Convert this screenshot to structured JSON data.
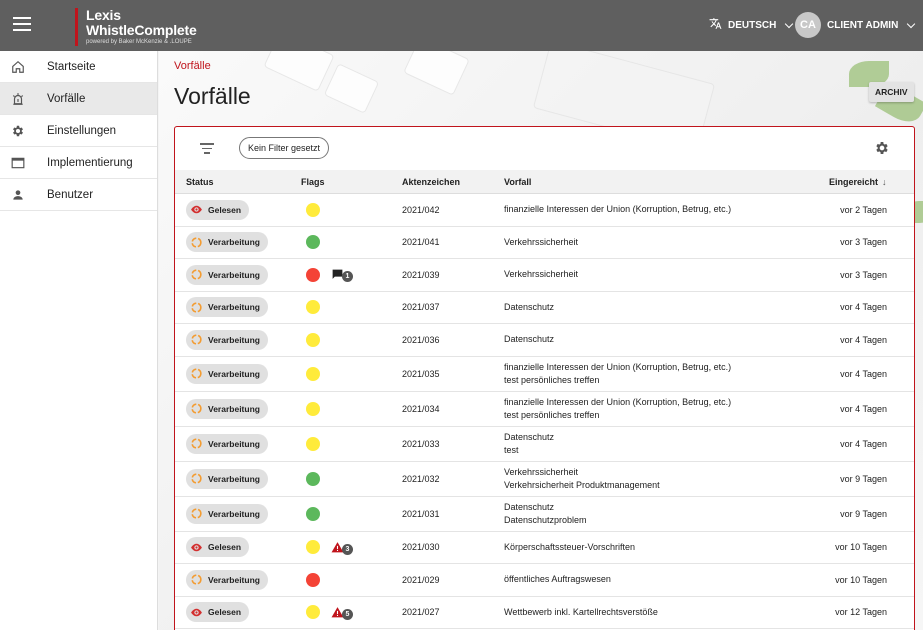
{
  "app": {
    "logo_line1": "Lexis",
    "logo_line2": "WhistleComplete",
    "logo_sub": "powered by Baker McKenzie & .LOUPE"
  },
  "header": {
    "language": "DEUTSCH",
    "user_initials": "CA",
    "user_name": "CLIENT ADMIN"
  },
  "sidebar": {
    "items": [
      {
        "label": "Startseite",
        "icon": "home-icon"
      },
      {
        "label": "Vorfälle",
        "icon": "incident-alarm-icon",
        "active": true
      },
      {
        "label": "Einstellungen",
        "icon": "gear-icon"
      },
      {
        "label": "Implementierung",
        "icon": "window-icon"
      },
      {
        "label": "Benutzer",
        "icon": "person-icon"
      }
    ]
  },
  "page": {
    "breadcrumb": "Vorfälle",
    "title": "Vorfälle",
    "archive_button": "ARCHIV"
  },
  "filter": {
    "chip_label": "Kein Filter gesetzt"
  },
  "table": {
    "columns": {
      "status": "Status",
      "flags": "Flags",
      "reference": "Aktenzeichen",
      "incident": "Vorfall",
      "received": "Eingereicht"
    },
    "rows": [
      {
        "status": "Gelesen",
        "status_type": "read",
        "flag_color": "#ffeb3b",
        "extra": null,
        "extra_count": null,
        "ref": "2021/042",
        "incident": [
          "finanzielle Interessen der Union (Korruption, Betrug, etc.)"
        ],
        "received": "vor 2 Tagen"
      },
      {
        "status": "Verarbeitung",
        "status_type": "processing",
        "flag_color": "#5cb85c",
        "extra": null,
        "extra_count": null,
        "ref": "2021/041",
        "incident": [
          "Verkehrssicherheit"
        ],
        "received": "vor 3 Tagen"
      },
      {
        "status": "Verarbeitung",
        "status_type": "processing",
        "flag_color": "#f44336",
        "extra": "message",
        "extra_count": "1",
        "ref": "2021/039",
        "incident": [
          "Verkehrssicherheit"
        ],
        "received": "vor 3 Tagen"
      },
      {
        "status": "Verarbeitung",
        "status_type": "processing",
        "flag_color": "#ffeb3b",
        "extra": null,
        "extra_count": null,
        "ref": "2021/037",
        "incident": [
          "Datenschutz"
        ],
        "received": "vor 4 Tagen"
      },
      {
        "status": "Verarbeitung",
        "status_type": "processing",
        "flag_color": "#ffeb3b",
        "extra": null,
        "extra_count": null,
        "ref": "2021/036",
        "incident": [
          "Datenschutz"
        ],
        "received": "vor 4 Tagen"
      },
      {
        "status": "Verarbeitung",
        "status_type": "processing",
        "flag_color": "#ffeb3b",
        "extra": null,
        "extra_count": null,
        "ref": "2021/035",
        "incident": [
          "finanzielle Interessen der Union (Korruption, Betrug, etc.)",
          "test persönliches treffen"
        ],
        "received": "vor 4 Tagen"
      },
      {
        "status": "Verarbeitung",
        "status_type": "processing",
        "flag_color": "#ffeb3b",
        "extra": null,
        "extra_count": null,
        "ref": "2021/034",
        "incident": [
          "finanzielle Interessen der Union (Korruption, Betrug, etc.)",
          "test persönliches treffen"
        ],
        "received": "vor 4 Tagen"
      },
      {
        "status": "Verarbeitung",
        "status_type": "processing",
        "flag_color": "#ffeb3b",
        "extra": null,
        "extra_count": null,
        "ref": "2021/033",
        "incident": [
          "Datenschutz",
          "test"
        ],
        "received": "vor 4 Tagen"
      },
      {
        "status": "Verarbeitung",
        "status_type": "processing",
        "flag_color": "#5cb85c",
        "extra": null,
        "extra_count": null,
        "ref": "2021/032",
        "incident": [
          "Verkehrssicherheit",
          "Verkehrsicherheit Produktmanagement"
        ],
        "received": "vor 9 Tagen"
      },
      {
        "status": "Verarbeitung",
        "status_type": "processing",
        "flag_color": "#5cb85c",
        "extra": null,
        "extra_count": null,
        "ref": "2021/031",
        "incident": [
          "Datenschutz",
          "Datenschutzproblem"
        ],
        "received": "vor 9 Tagen"
      },
      {
        "status": "Gelesen",
        "status_type": "read",
        "flag_color": "#ffeb3b",
        "extra": "warning",
        "extra_count": "3",
        "ref": "2021/030",
        "incident": [
          "Körperschaftssteuer-Vorschriften"
        ],
        "received": "vor 10 Tagen"
      },
      {
        "status": "Verarbeitung",
        "status_type": "processing",
        "flag_color": "#f44336",
        "extra": null,
        "extra_count": null,
        "ref": "2021/029",
        "incident": [
          "öffentliches Auftragswesen"
        ],
        "received": "vor 10 Tagen"
      },
      {
        "status": "Gelesen",
        "status_type": "read",
        "flag_color": "#ffeb3b",
        "extra": "warning",
        "extra_count": "5",
        "ref": "2021/027",
        "incident": [
          "Wettbewerb inkl. Kartellrechtsverstöße"
        ],
        "received": "vor 12 Tagen"
      }
    ]
  },
  "colors": {
    "accent_red": "#c0141c",
    "topbar": "#5f5f5f",
    "processing_orange": "#f39c32",
    "read_red": "#d32f2f"
  }
}
